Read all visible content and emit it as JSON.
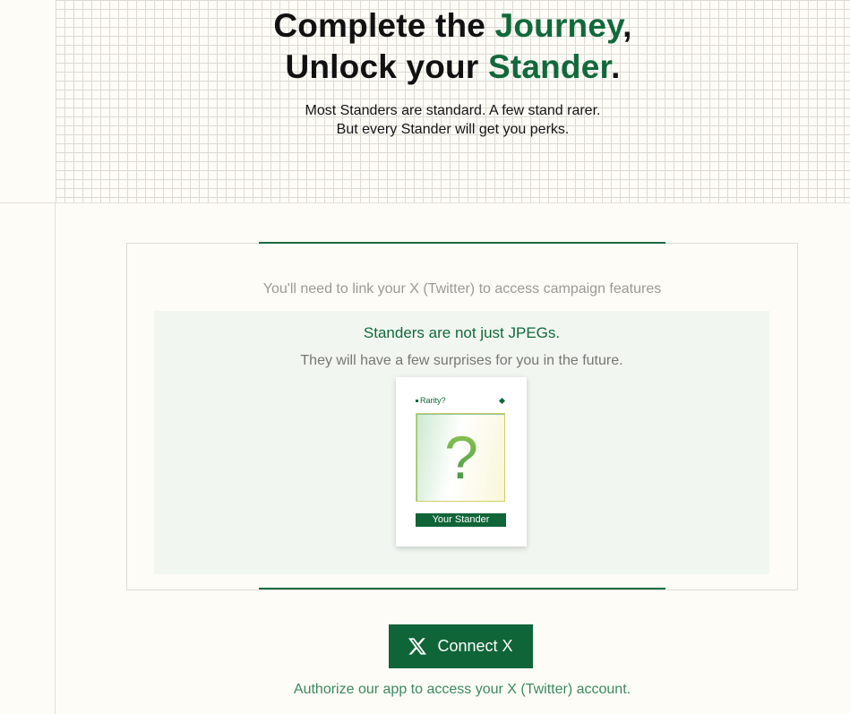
{
  "hero": {
    "line1_prefix": "Complete the ",
    "line1_accent": "Journey",
    "line1_suffix": ",",
    "line2_prefix": "Unlock your ",
    "line2_accent": "Stander",
    "line2_suffix": ".",
    "subtitle_line1": "Most Standers are standard. A few stand rarer.",
    "subtitle_line2": "But every Stander will get you perks."
  },
  "card": {
    "link_notice": "You'll need to link your X (Twitter) to access campaign features",
    "panel_title": "Standers are not just JPEGs.",
    "panel_desc": "They will have a few surprises for you in the future.",
    "nft": {
      "rarity_label": "Rarity?",
      "placeholder_glyph": "?",
      "name_label": "Your Stander"
    }
  },
  "connect": {
    "button_label": "Connect X",
    "icon": "x-logo-icon",
    "authorize_text": "Authorize our app to access your X (Twitter) account."
  },
  "colors": {
    "brand_green": "#11693b",
    "button_green": "#0f6538",
    "page_bg": "#fdfcf7",
    "panel_bg": "#f1f6f1"
  }
}
